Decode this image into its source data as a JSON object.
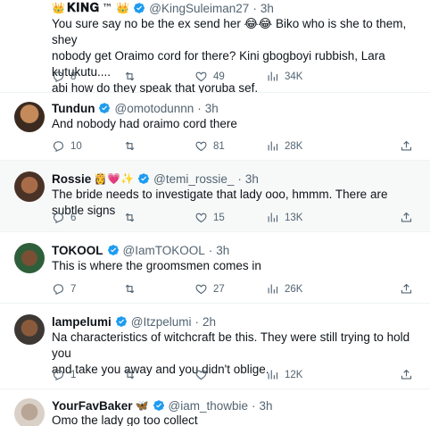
{
  "tweets": [
    {
      "name": "𝐊𝐈𝐍𝐆",
      "name_emoji_left": "👑",
      "name_emoji_right": "™ 👑",
      "handle": "@KingSuleiman27",
      "time": "3h",
      "lines": [
        "You sure say no be the ex send her 😂😂 Biko who is she to them, shey",
        "nobody get Oraimo cord for there? Kini gbogboyi rubbish, Lara kutukutu....",
        "abi how do they speak that yoruba sef."
      ],
      "replies": "8",
      "retweets": "",
      "likes": "49",
      "views": "34K"
    },
    {
      "name": "Tundun",
      "handle": "@omotodunnn",
      "time": "3h",
      "lines": [
        "And nobody had oraimo cord there"
      ],
      "replies": "10",
      "retweets": "",
      "likes": "81",
      "views": "28K"
    },
    {
      "name": "Rossie",
      "name_emoji_right": "👸💗✨",
      "handle": "@temi_rossie_",
      "time": "3h",
      "lines": [
        "The bride needs to investigate that lady ooo, hmmm. There are subtle signs"
      ],
      "replies": "6",
      "retweets": "",
      "likes": "15",
      "views": "13K"
    },
    {
      "name": "TOKOOL",
      "handle": "@IamTOKOOL",
      "time": "3h",
      "lines": [
        "This is where the groomsmen comes in"
      ],
      "replies": "7",
      "retweets": "",
      "likes": "27",
      "views": "26K"
    },
    {
      "name": "lampelumi",
      "handle": "@Itzpelumi",
      "time": "2h",
      "lines": [
        "Na characteristics of witchcraft be this. They were still trying to hold you",
        "and take you away and you didn't oblige."
      ],
      "replies": "1",
      "retweets": "",
      "likes": "",
      "views": "12K"
    },
    {
      "name": "YourFavBaker",
      "name_emoji_right": "🦋",
      "handle": "@iam_thowbie",
      "time": "3h",
      "lines": [
        "Omo the lady go too collect"
      ]
    }
  ],
  "icons": {
    "reply": "reply-icon",
    "retweet": "retweet-icon",
    "like": "like-icon",
    "views": "views-icon",
    "share": "share-icon",
    "verified": "verified-badge-icon"
  },
  "colors": {
    "verified": "#1d9bf0",
    "muted": "#536471",
    "text": "#0f1419",
    "highlight_bg": "#f7f9f9"
  }
}
